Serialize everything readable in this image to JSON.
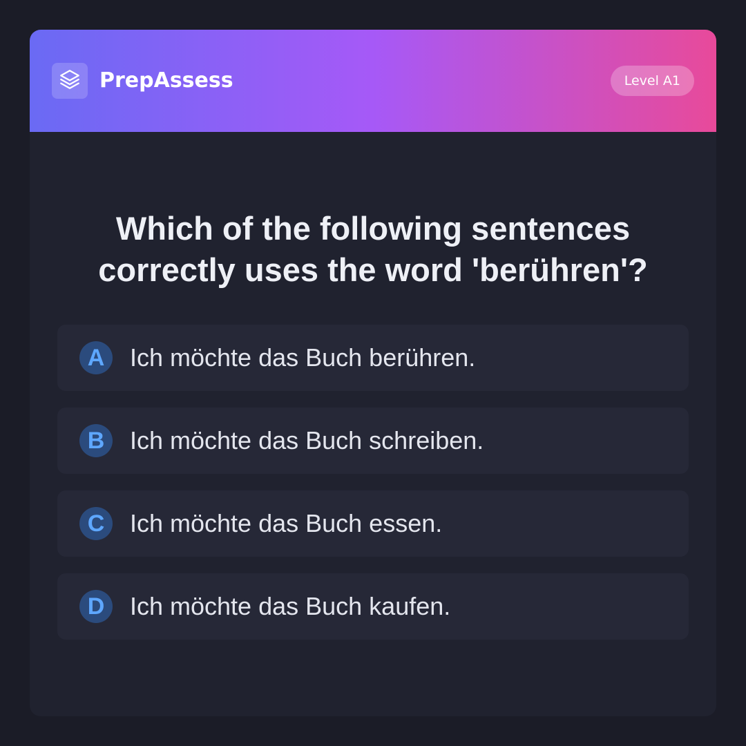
{
  "header": {
    "logo_icon": "layers-icon",
    "brand": "PrepAssess",
    "level": "Level A1"
  },
  "question": {
    "text": "Which of the following sentences correctly uses the word 'berühren'?"
  },
  "options": [
    {
      "letter": "A",
      "text": "Ich möchte das Buch berühren."
    },
    {
      "letter": "B",
      "text": "Ich möchte das Buch schreiben."
    },
    {
      "letter": "C",
      "text": "Ich möchte das Buch essen."
    },
    {
      "letter": "D",
      "text": "Ich möchte das Buch kaufen."
    }
  ],
  "colors": {
    "background": "#1b1c27",
    "card": "#20222f",
    "option_bg": "#262837",
    "gradient_start": "#6a6af4",
    "gradient_mid": "#a659f7",
    "gradient_end": "#e84a9a",
    "letter_circle": "#2b4b7d",
    "letter_text": "#5ea7ff"
  }
}
